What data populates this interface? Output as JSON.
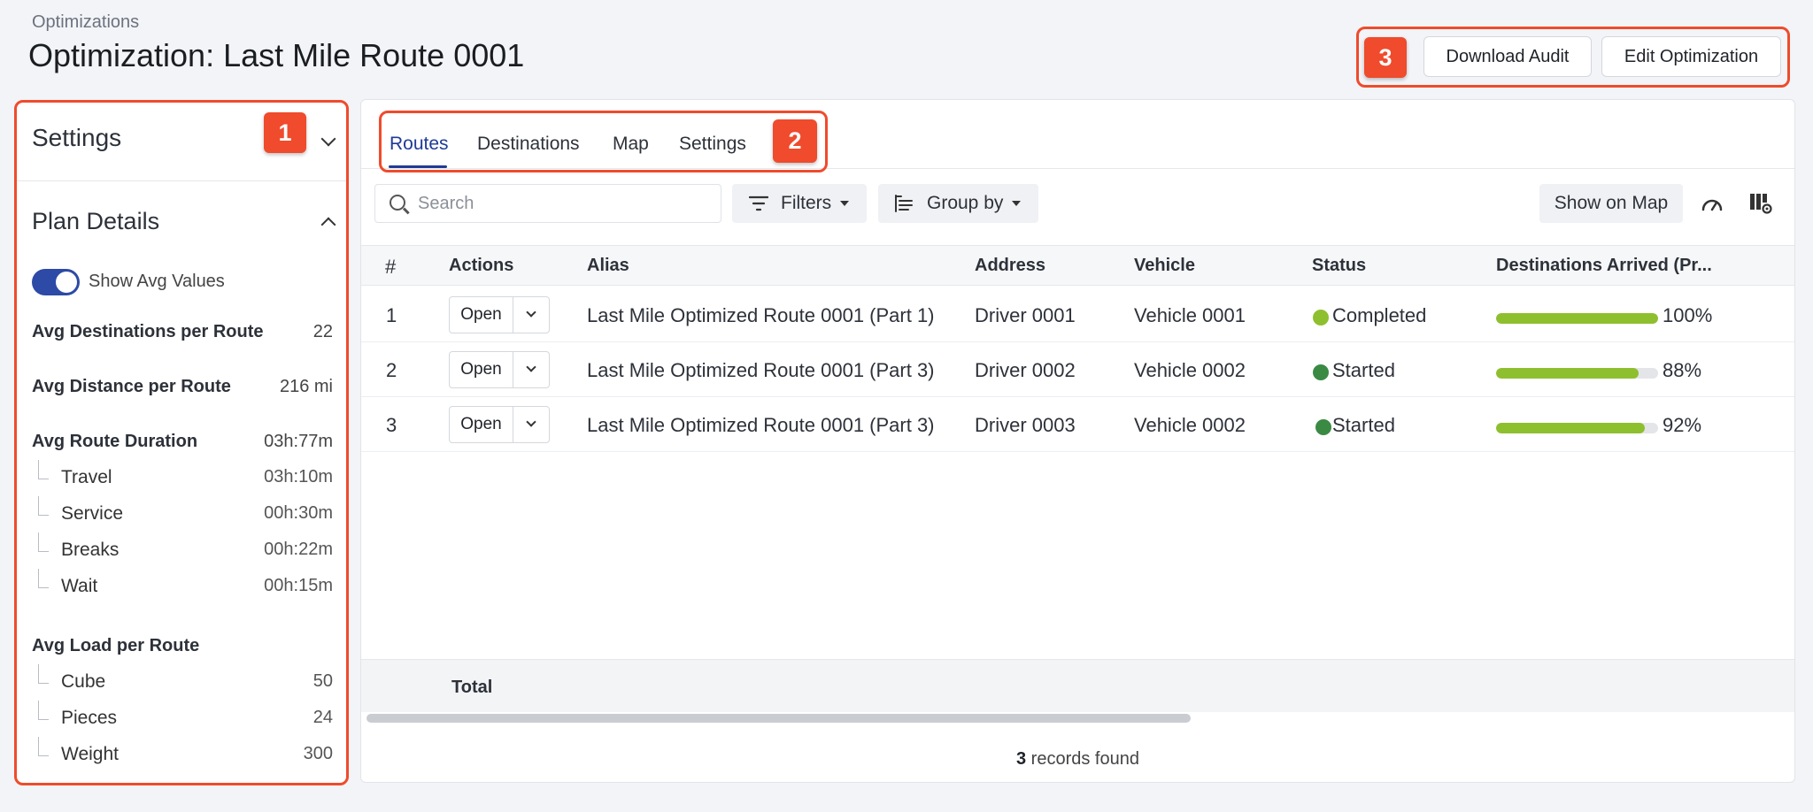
{
  "header": {
    "breadcrumb": "Optimizations",
    "title": "Optimization: Last Mile Route 0001",
    "download_audit": "Download Audit",
    "edit_optimization": "Edit Optimization"
  },
  "callouts": [
    "1",
    "2",
    "3"
  ],
  "sidebar": {
    "title": "Settings",
    "plan_title": "Plan Details",
    "toggle_label": "Show Avg Values",
    "toggle_on": true,
    "avg_destinations": {
      "label": "Avg Destinations per Route",
      "value": "22"
    },
    "avg_distance": {
      "label": "Avg Distance per Route",
      "value": "216 mi"
    },
    "avg_duration": {
      "label": "Avg Route Duration",
      "value": "03h:77m",
      "items": [
        {
          "label": "Travel",
          "value": "03h:10m"
        },
        {
          "label": "Service",
          "value": "00h:30m"
        },
        {
          "label": "Breaks",
          "value": "00h:22m"
        },
        {
          "label": "Wait",
          "value": "00h:15m"
        }
      ]
    },
    "avg_load": {
      "label": "Avg Load per Route",
      "items": [
        {
          "label": "Cube",
          "value": "50"
        },
        {
          "label": "Pieces",
          "value": "24"
        },
        {
          "label": "Weight",
          "value": "300"
        }
      ]
    }
  },
  "tabs": [
    "Routes",
    "Destinations",
    "Map",
    "Settings"
  ],
  "toolbar": {
    "search_placeholder": "Search",
    "filters": "Filters",
    "group_by": "Group by",
    "show_on_map": "Show on Map"
  },
  "table": {
    "columns": [
      "#",
      "Actions",
      "Alias",
      "Address",
      "Vehicle",
      "Status",
      "Destinations Arrived (Pr..."
    ],
    "open_label": "Open",
    "rows": [
      {
        "num": "1",
        "alias": "Last Mile Optimized Route 0001 (Part 1)",
        "address": "Driver 0001",
        "vehicle": "Vehicle 0001",
        "status": "Completed",
        "status_color": "#8ebf2e",
        "progress": 1.0,
        "progress_label": "100%"
      },
      {
        "num": "2",
        "alias": "Last Mile Optimized Route 0001 (Part 3)",
        "address": "Driver 0002",
        "vehicle": "Vehicle 0002",
        "status": "Started",
        "status_color": "#3a8a44",
        "progress": 0.88,
        "progress_label": "88%"
      },
      {
        "num": "3",
        "alias": "Last Mile Optimized Route 0001 (Part 3)",
        "address": "Driver 0003",
        "vehicle": "Vehicle 0002",
        "status": "Started",
        "status_color": "#3a8a44",
        "progress": 0.92,
        "progress_label": "92%"
      }
    ],
    "total_label": "Total",
    "records_count": "3",
    "records_text": " records found"
  }
}
